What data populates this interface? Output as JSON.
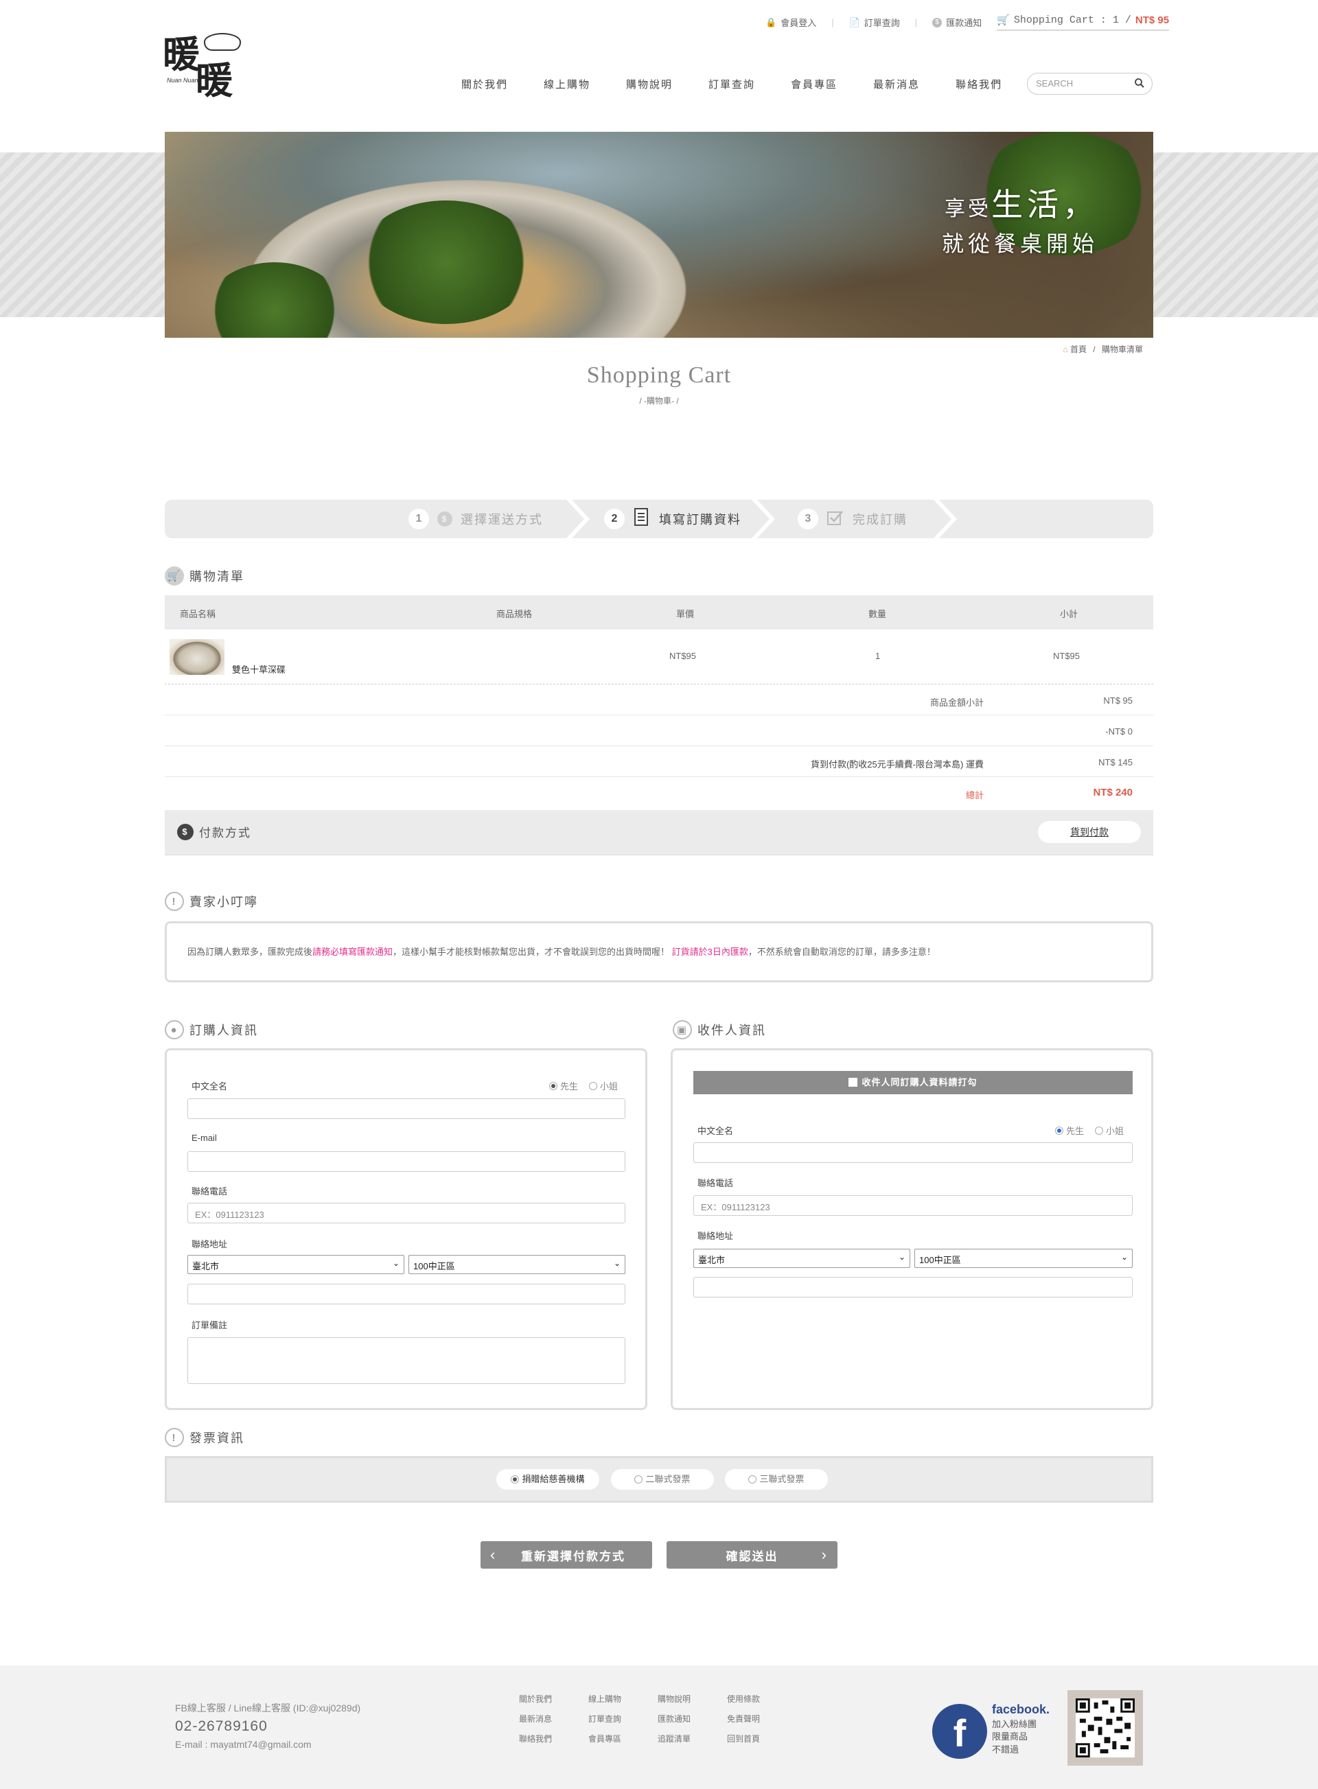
{
  "header": {
    "top_links": [
      {
        "icon": "lock-icon",
        "label": "會員登入"
      },
      {
        "icon": "document-icon",
        "label": "訂單查詢"
      },
      {
        "icon": "dollar-icon",
        "label": "匯款通知"
      }
    ],
    "cart": {
      "label": "Shopping Cart : 1 /",
      "total": "NT$ 95"
    },
    "logo": {
      "text1": "暖",
      "text2": "暖",
      "tagline": "Nuan Nuan"
    },
    "nav": [
      "關於我們",
      "線上購物",
      "購物說明",
      "訂單查詢",
      "會員專區",
      "最新消息",
      "聯絡我們"
    ],
    "search_placeholder": "SEARCH"
  },
  "banner": {
    "slogan_prefix": "享受",
    "slogan_big": "生活，",
    "slogan_line2": "就從餐桌開始"
  },
  "breadcrumb": {
    "home": "首頁",
    "sep": "/",
    "current": "購物車清單"
  },
  "page": {
    "title": "Shopping Cart",
    "subtitle": "/ -購物車- /"
  },
  "steps": [
    {
      "num": "1",
      "label": "選擇運送方式"
    },
    {
      "num": "2",
      "label": "填寫訂購資料"
    },
    {
      "num": "3",
      "label": "完成訂購"
    }
  ],
  "cart": {
    "title": "購物清單",
    "columns": [
      "商品名稱",
      "商品規格",
      "單價",
      "數量",
      "小計"
    ],
    "items": [
      {
        "name": "雙色十草深碟",
        "spec": "",
        "price": "NT$95",
        "qty": "1",
        "subtotal": "NT$95"
      }
    ],
    "summary": [
      {
        "label": "商品金額小計",
        "value": "NT$ 95"
      },
      {
        "label": "",
        "value": "-NT$ 0"
      },
      {
        "label": "貨到付款(酌收25元手續費-限台灣本島) 運費",
        "value": "NT$ 145"
      },
      {
        "label": "總計",
        "value": "NT$ 240"
      }
    ],
    "payment_label": "付款方式",
    "payment_value": "貨到付款"
  },
  "notice": {
    "title": "賣家小叮嚀",
    "part1": "因為訂購人數眾多，匯款完成後",
    "highlight1": "請務必填寫匯款通知",
    "part2": "，這樣小幫手才能核對帳款幫您出貨，才不會耽誤到您的出貨時間喔！",
    "highlight2": "訂貨請於3日內匯款",
    "part3": "，不然系統會自動取消您的訂單，請多多注意！"
  },
  "buyer": {
    "title": "訂購人資訊",
    "name_label": "中文全名",
    "gender_options": [
      "先生",
      "小姐"
    ],
    "email_label": "E-mail",
    "phone_label": "聯絡電話",
    "phone_placeholder": "EX：0911123123",
    "address_label": "聯絡地址",
    "city": "臺北市",
    "district": "100中正區",
    "note_label": "訂單備註"
  },
  "receiver": {
    "title": "收件人資訊",
    "same_as_buyer": "收件人同訂購人資料請打勾",
    "name_label": "中文全名",
    "gender_options": [
      "先生",
      "小姐"
    ],
    "phone_label": "聯絡電話",
    "phone_placeholder": "EX：0911123123",
    "address_label": "聯絡地址",
    "city": "臺北市",
    "district": "100中正區"
  },
  "invoice": {
    "title": "發票資訊",
    "options": [
      "捐贈給慈善機構",
      "二聯式發票",
      "三聯式發票"
    ]
  },
  "buttons": {
    "back": "重新選擇付款方式",
    "submit": "確認送出"
  },
  "footer": {
    "service": "FB線上客服 / Line線上客服 (ID:@xuj0289d)",
    "phone": "02-26789160",
    "email": "E-mail : mayatmt74@gmail.com",
    "links": [
      "關於我們",
      "線上購物",
      "購物說明",
      "使用條款",
      "最新消息",
      "訂單查詢",
      "匯款通知",
      "免責聲明",
      "聯絡我們",
      "會員專區",
      "追蹤清單",
      "回到首頁"
    ],
    "fb_brand": "facebook.",
    "fb_lines": [
      "加入粉絲團",
      "限量商品",
      "不錯過"
    ]
  },
  "colors": {
    "accent": "#e15b4b",
    "highlight": "#e0308a",
    "button": "#8c8c8c",
    "panel_border": "#dddddd"
  }
}
